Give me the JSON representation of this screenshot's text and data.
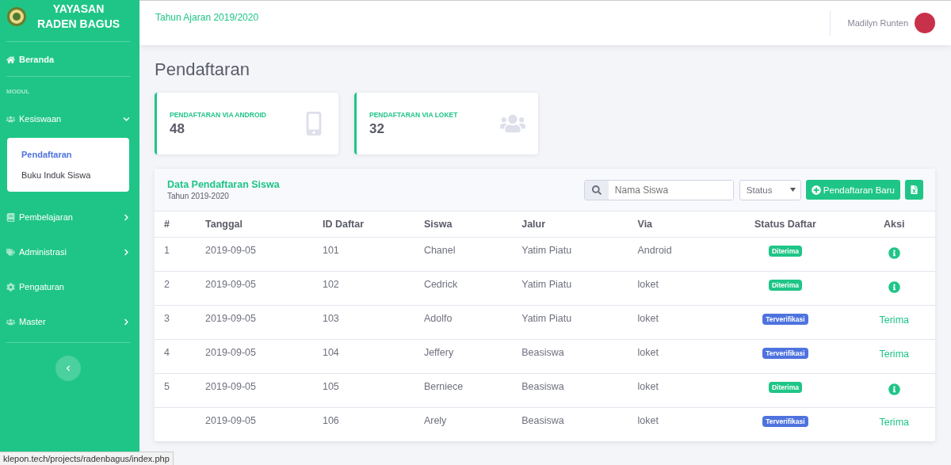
{
  "brand": {
    "line_1": "YAYASAN",
    "line_2": "RADEN BAGUS"
  },
  "sidebar": {
    "home": {
      "label": "Beranda",
      "selected": false
    },
    "section": "MODUL",
    "items": [
      {
        "label": "Kesiswaan",
        "kind": "group",
        "expanded": true,
        "children": [
          {
            "label": "Pendaftaran",
            "selected": true
          },
          {
            "label": "Buku Induk Siswa",
            "selected": false
          }
        ]
      },
      {
        "label": "Pembelajaran",
        "kind": "group",
        "expanded": false
      },
      {
        "label": "Administrasi",
        "kind": "group",
        "expanded": false
      },
      {
        "label": "Pengaturan",
        "kind": "link"
      },
      {
        "label": "Master",
        "kind": "group",
        "expanded": false
      }
    ]
  },
  "topbar": {
    "school_year": "Tahun Ajaran 2019/2020",
    "user": "Madilyn Runten"
  },
  "page_title": "Pendaftaran",
  "stats": [
    {
      "label": "PENDAFTARAN VIA ANDROID",
      "value": "48"
    },
    {
      "label": "PENDAFTARAN VIA LOKET",
      "value": "32"
    }
  ],
  "table_card": {
    "title": "Data Pendaftaran Siswa",
    "subtitle": "Tahun 2019-2020",
    "search": {
      "placeholder": "Nama Siswa"
    },
    "status_filter": "Status",
    "new_button": "Pendaftaran Baru",
    "columns": [
      "#",
      "Tanggal",
      "ID Daftar",
      "Siswa",
      "Jalur",
      "Via",
      "Status Daftar",
      "Aksi"
    ],
    "rows": [
      {
        "no": "1",
        "date": "2019-09-05",
        "id": "101",
        "student": "Chanel",
        "track": "Yatim Piatu",
        "via": "Android",
        "status": {
          "kind": "accepted",
          "label": "Diterima"
        },
        "action": {
          "kind": "info"
        }
      },
      {
        "no": "2",
        "date": "2019-09-05",
        "id": "102",
        "student": "Cedrick",
        "track": "Yatim Piatu",
        "via": "loket",
        "status": {
          "kind": "accepted",
          "label": "Diterima"
        },
        "action": {
          "kind": "info"
        }
      },
      {
        "no": "3",
        "date": "2019-09-05",
        "id": "103",
        "student": "Adolfo",
        "track": "Yatim Piatu",
        "via": "loket",
        "status": {
          "kind": "verified",
          "label": "Terverifikasi"
        },
        "action": {
          "kind": "accept",
          "label": "Terima"
        }
      },
      {
        "no": "4",
        "date": "2019-09-05",
        "id": "104",
        "student": "Jeffery",
        "track": "Beasiswa",
        "via": "loket",
        "status": {
          "kind": "verified",
          "label": "Terverifikasi"
        },
        "action": {
          "kind": "accept",
          "label": "Terima"
        }
      },
      {
        "no": "5",
        "date": "2019-09-05",
        "id": "105",
        "student": "Berniece",
        "track": "Beasiswa",
        "via": "loket",
        "status": {
          "kind": "accepted",
          "label": "Diterima"
        },
        "action": {
          "kind": "info"
        }
      },
      {
        "date": "2019-09-05",
        "id": "106",
        "student": "Arely",
        "track": "Beasiswa",
        "via": "loket",
        "status": {
          "kind": "verified",
          "label": "Terverifikasi"
        },
        "action": {
          "kind": "accept",
          "label": "Terima"
        }
      }
    ]
  },
  "status_bar": "klepon.tech/projects/radenbagus/index.php"
}
